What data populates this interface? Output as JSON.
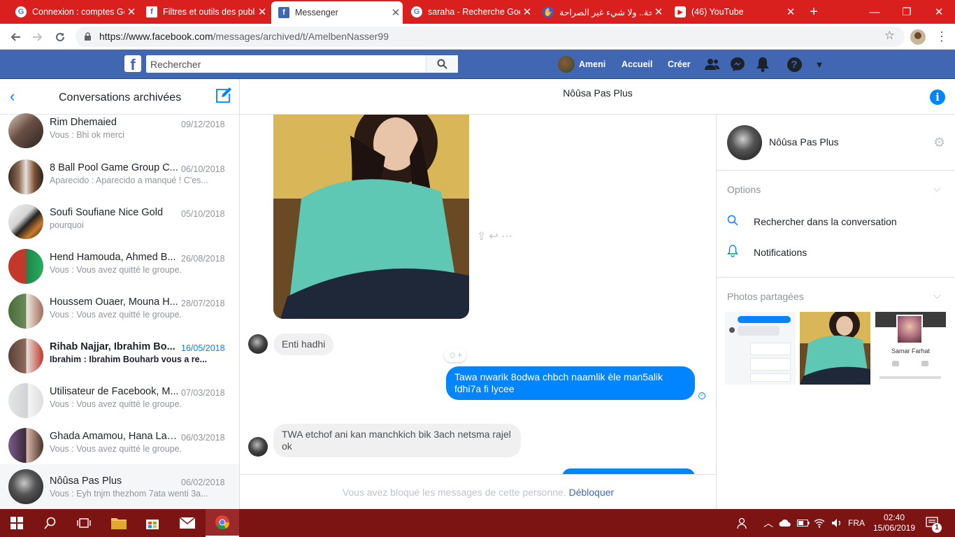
{
  "browser": {
    "tabs": [
      {
        "title": "Connexion : comptes Google",
        "icon": "google-icon"
      },
      {
        "title": "Filtres et outils des publications",
        "icon": "facebook-icon"
      },
      {
        "title": "Messenger",
        "icon": "facebook-icon",
        "active": true
      },
      {
        "title": "saraha - Recherche Google",
        "icon": "google-icon"
      },
      {
        "title": "الصراحة.. ولا شيء غير الصراحة",
        "icon": "saraha-icon"
      },
      {
        "title": "(46) YouTube",
        "icon": "youtube-icon"
      }
    ],
    "url_host": "https://www.facebook.com",
    "url_path": "/messages/archived/t/AmelbenNasser99"
  },
  "fb_header": {
    "search_placeholder": "Rechercher",
    "user_name": "Ameni",
    "home_label": "Accueil",
    "create_label": "Créer"
  },
  "sidebar": {
    "title": "Conversations archivées",
    "conversations": [
      {
        "name": "Rim Dhemaied",
        "date": "09/12/2018",
        "snippet": "Vous : Bhi ok merci"
      },
      {
        "name": "8 Ball Pool Game Group C...",
        "date": "06/10/2018",
        "snippet": "Aparecido : Aparecido a manqué ! C'es..."
      },
      {
        "name": "Soufi Soufiane Nice Gold",
        "date": "05/10/2018",
        "snippet": "pourquoi"
      },
      {
        "name": "Hend Hamouda, Ahmed B...",
        "date": "26/08/2018",
        "snippet": "Vous : Vous avez quitté le groupe."
      },
      {
        "name": "Houssem Ouaer, Mouna H...",
        "date": "28/07/2018",
        "snippet": "Vous : Vous avez quitté le groupe."
      },
      {
        "name": "Rihab Najjar, Ibrahim Bo...",
        "date": "16/05/2018",
        "snippet": "Ibrahim : Ibrahim Bouharb vous a re...",
        "unread": true
      },
      {
        "name": "Utilisateur de Facebook, M...",
        "date": "07/03/2018",
        "snippet": "Vous : Vous avez quitté le groupe."
      },
      {
        "name": "Ghada Amamou, Hana Lac...",
        "date": "06/03/2018",
        "snippet": "Vous : Vous avez quitté le groupe."
      },
      {
        "name": "Nôûsa Pas Plus",
        "date": "06/02/2018",
        "snippet": "Vous : Eyh tnjm thezhom 7ata wenti 3a...",
        "selected": true
      }
    ]
  },
  "conversation": {
    "title": "Nôûsa Pas Plus",
    "messages": [
      {
        "from": "them",
        "text": "Enti hadhi"
      },
      {
        "from": "me",
        "text": "Tawa nwarik 8odwa chbch naamlik èle man5alik fdhi7a fi lycee"
      },
      {
        "from": "them",
        "text": "TWA etchof ani kan manchkich bik 3ach netsma rajel ok"
      }
    ],
    "blocked_text": "Vous avez bloqué les messages de cette personne.",
    "unblock_label": "Débloquer"
  },
  "right_panel": {
    "name": "Nôûsa Pas Plus",
    "options_label": "Options",
    "search_label": "Rechercher dans la conversation",
    "notifications_label": "Notifications",
    "photos_label": "Photos partagées",
    "thumb3_name": "Samar Farhat"
  },
  "taskbar": {
    "language": "FRA",
    "time": "02:40",
    "date": "15/06/2019",
    "notif_count": "1"
  }
}
